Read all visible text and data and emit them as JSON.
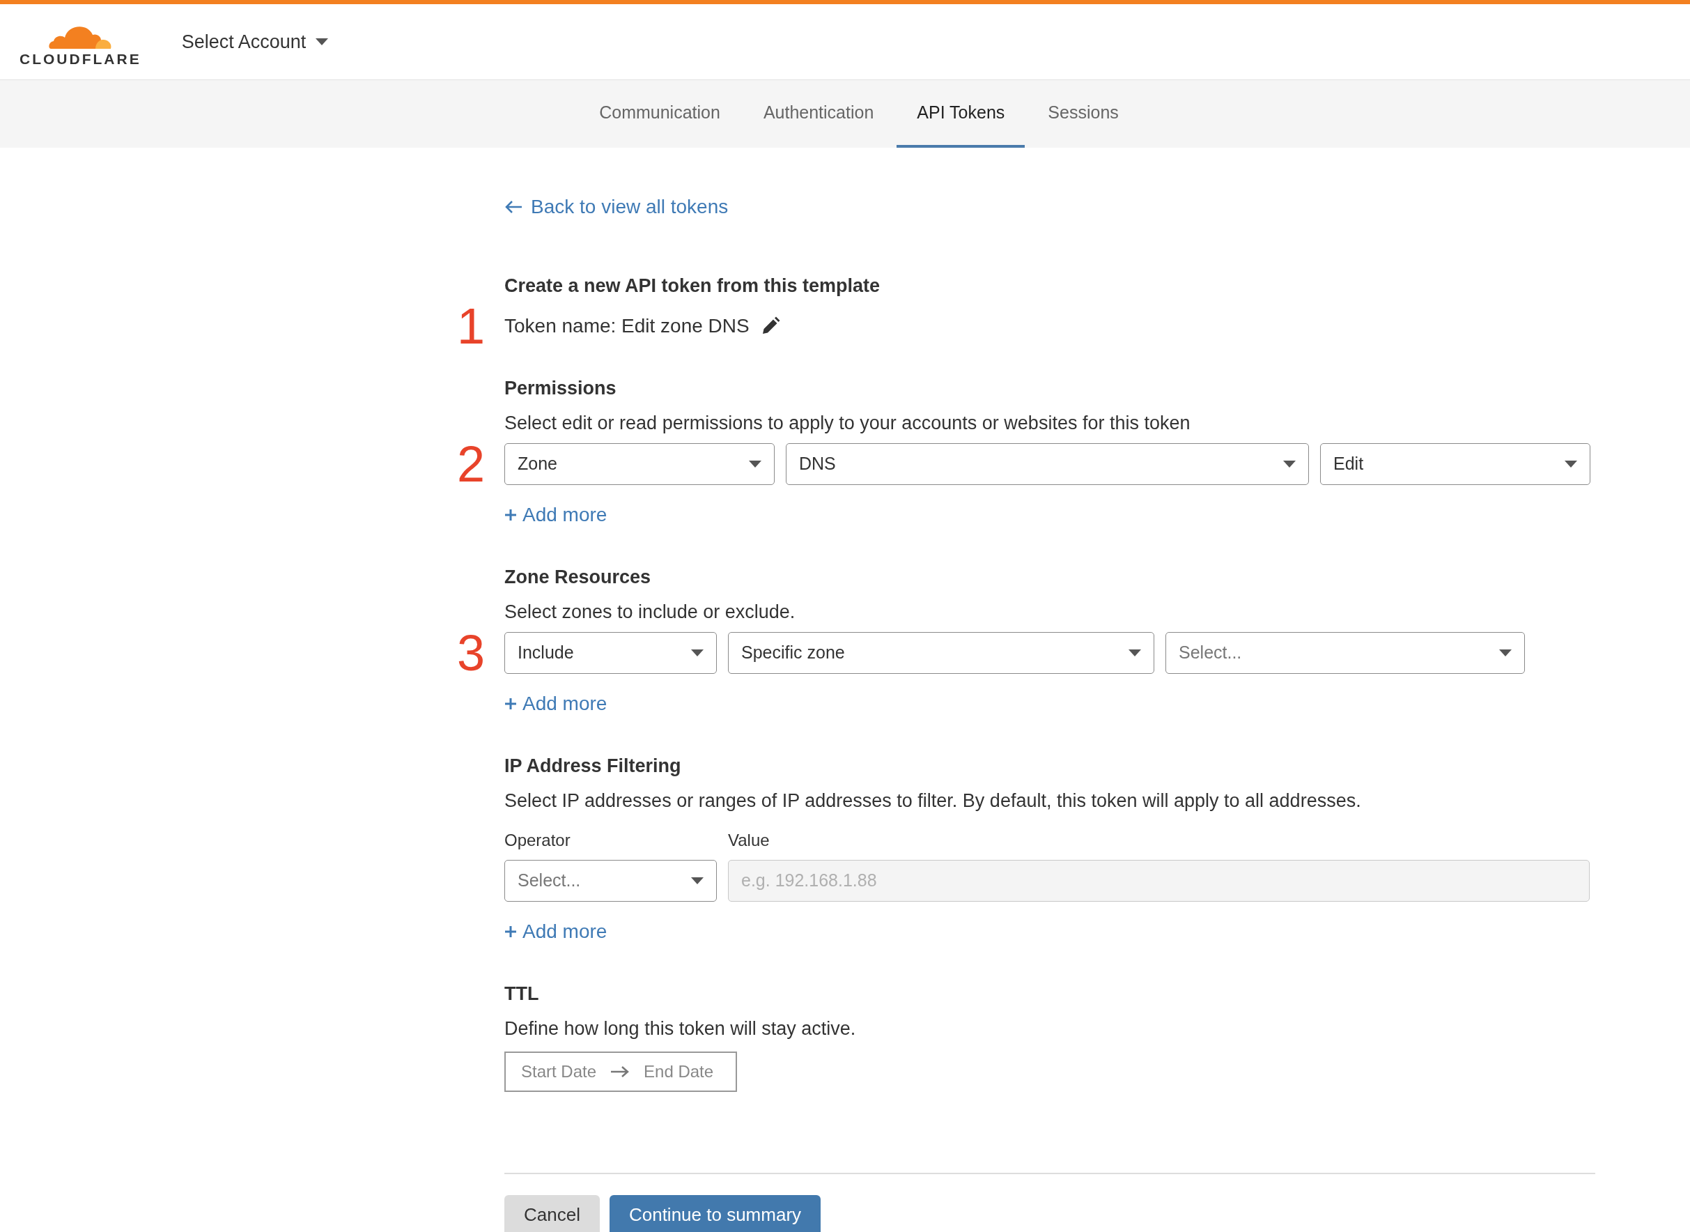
{
  "header": {
    "logo_text": "CLOUDFLARE",
    "account_select": "Select Account"
  },
  "tabs": [
    {
      "label": "Communication",
      "selected": false
    },
    {
      "label": "Authentication",
      "selected": false
    },
    {
      "label": "API Tokens",
      "selected": true
    },
    {
      "label": "Sessions",
      "selected": false
    }
  ],
  "back_link": "Back to view all tokens",
  "token": {
    "heading": "Create a new API token from this template",
    "name": "Token name: Edit zone DNS",
    "step": "1"
  },
  "sections": [
    {
      "kind": "selects",
      "title": "Permissions",
      "description": "Select edit or read permissions to apply to your accounts or websites for this token",
      "step": "2",
      "fields": [
        {
          "kind": "select",
          "value": "Zone"
        },
        {
          "kind": "select",
          "value": "DNS"
        },
        {
          "kind": "select",
          "value": "Edit"
        }
      ],
      "add_more": "Add more"
    },
    {
      "kind": "selects",
      "title": "Zone Resources",
      "description": "Select zones to include or exclude.",
      "step": "3",
      "fields": [
        {
          "kind": "select",
          "value": "Include"
        },
        {
          "kind": "select",
          "value": "Specific zone"
        },
        {
          "kind": "select",
          "placeholder": "Select..."
        }
      ],
      "add_more": "Add more"
    },
    {
      "kind": "labeled",
      "title": "IP Address Filtering",
      "description": "Select IP addresses or ranges of IP addresses to filter. By default, this token will apply to all addresses.",
      "fields": [
        {
          "kind": "select",
          "label": "Operator",
          "placeholder": "Select..."
        },
        {
          "kind": "input",
          "label": "Value",
          "placeholder": "e.g. 192.168.1.88"
        }
      ],
      "add_more": "Add more"
    },
    {
      "kind": "daterange",
      "title": "TTL",
      "description": "Define how long this token will stay active.",
      "start": "Start Date",
      "end": "End Date"
    }
  ],
  "buttons": [
    {
      "kind": "secondary",
      "label": "Cancel"
    },
    {
      "kind": "primary",
      "label": "Continue to summary"
    }
  ]
}
